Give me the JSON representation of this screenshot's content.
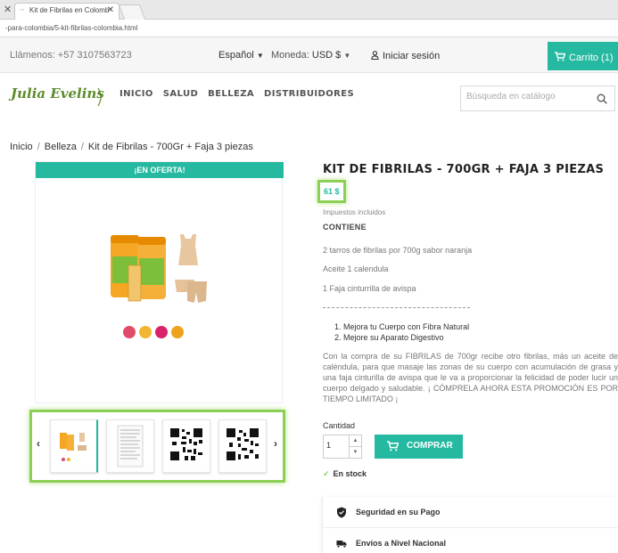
{
  "browser": {
    "tab_title": "Kit de Fibrilas en Colomb",
    "url": "-para-colombia/5-kit-fibrilas-colombia.html"
  },
  "topbar": {
    "phone": "Llámenos: +57 3107563723",
    "language": "Español",
    "currency_label": "Moneda:",
    "currency_value": "USD $",
    "login": "Iniciar sesión",
    "cart": "Carrito (1)"
  },
  "header": {
    "logo_text": "Julia Evelins",
    "nav": [
      "INICIO",
      "SALUD",
      "BELLEZA",
      "DISTRIBUIDORES"
    ],
    "search_placeholder": "Búsqueda en catálogo"
  },
  "breadcrumb": [
    "Inicio",
    "Belleza",
    "Kit de Fibrilas - 700Gr + Faja 3 piezas"
  ],
  "product": {
    "offer_banner": "¡EN OFERTA!",
    "title": "KIT DE FIBRILAS - 700GR + FAJA 3 PIEZAS",
    "price": "61 $",
    "tax_note": "Impuestos incluidos",
    "contains_heading": "CONTIENE",
    "contents": [
      "2 tarros de fibrilas por 700g sabor naranja",
      "Aceite 1 calendula",
      "1 Faja cinturrilla de avispa"
    ],
    "benefits": [
      "1. Mejora tu Cuerpo con Fibra Natural",
      "2. Mejore su Aparato Digestivo"
    ],
    "description": "Con la compra de su FIBRILAS  de 700gr recibe otro fibrilas, más un aceite de caléndula, para que masaje las zonas de su cuerpo con acumulación de grasa y una faja cinturilla de avispa que le va a proporcionar la felicidad de poder lucir un cuerpo delgado y saludable.  ¡ CÓMPRELA AHORA ESTA PROMOCIÓN ES POR TIEMPO LIMITADO ¡",
    "quantity_label": "Cantidad",
    "quantity": "1",
    "buy_label": "COMPRAR",
    "stock": "En stock",
    "badge_colors": [
      "#e24c6b",
      "#f2b632",
      "#d8226a",
      "#f0a21c"
    ]
  },
  "reassurance": [
    {
      "label": "Seguridad en su Pago",
      "icon": "shield-icon"
    },
    {
      "label": "Envíos a Nivel Nacional",
      "icon": "truck-icon"
    }
  ],
  "colors": {
    "accent": "#24b9a0",
    "highlight": "#8ccf55"
  }
}
